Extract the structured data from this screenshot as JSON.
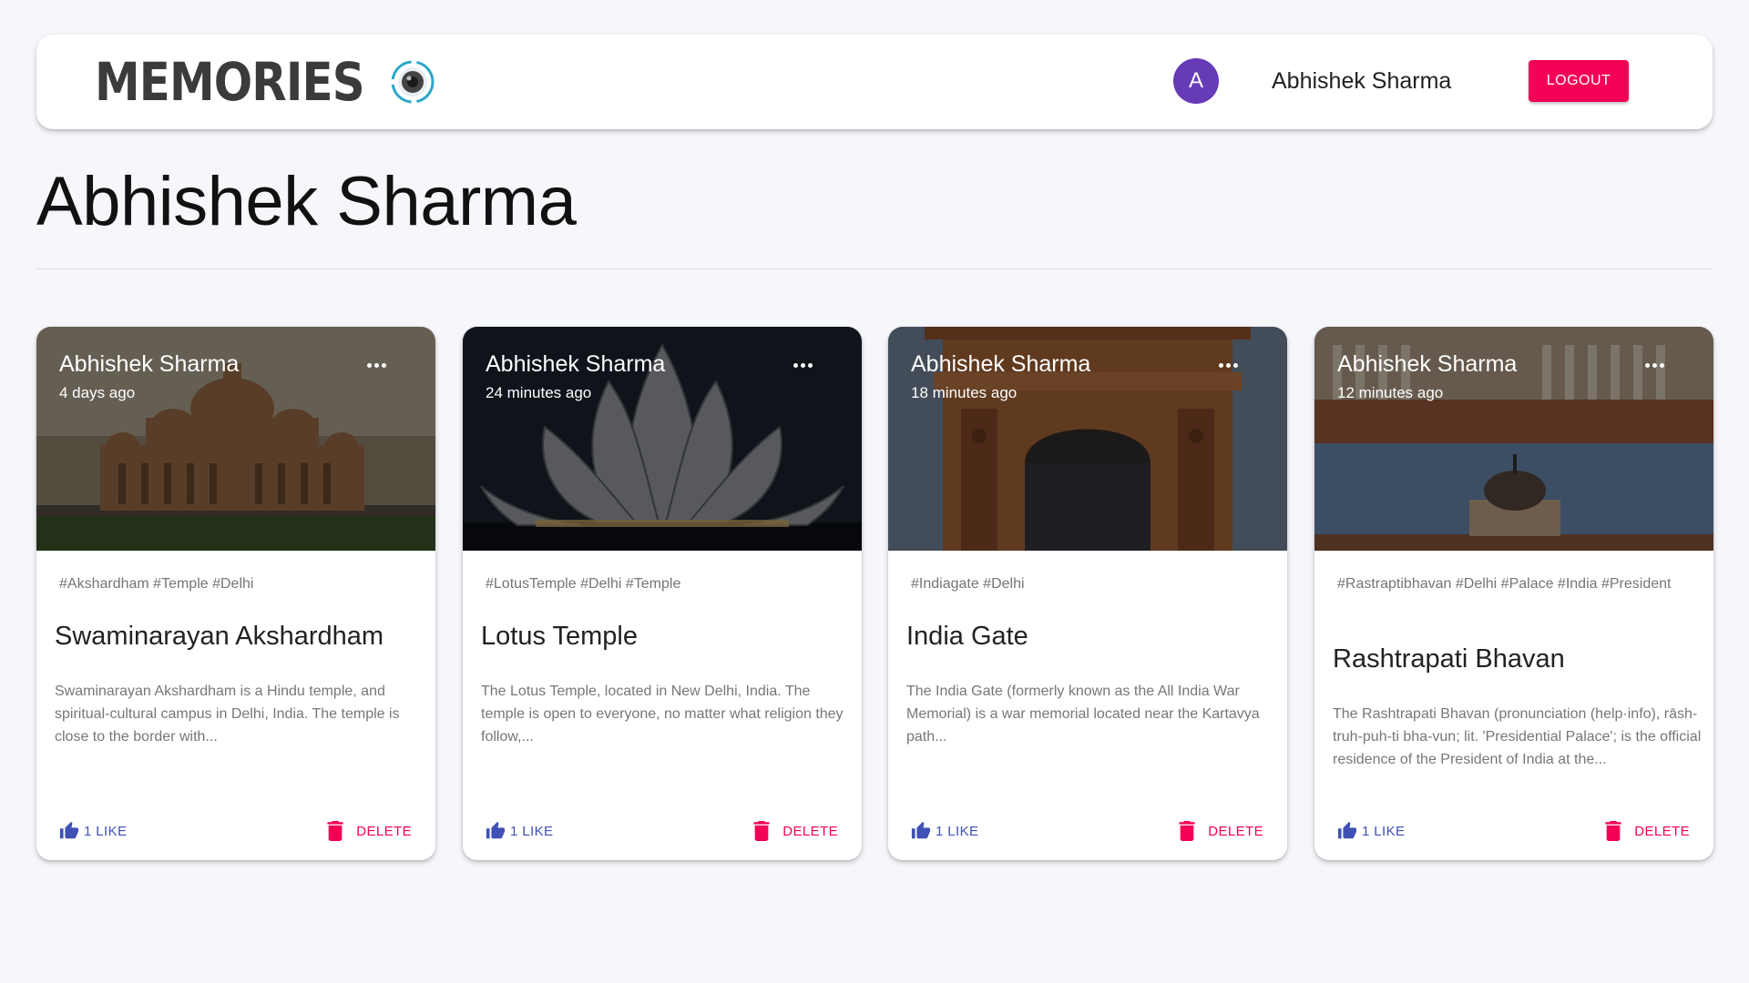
{
  "appbar": {
    "brand_title": "Memories",
    "avatar_initial": "A",
    "username": "Abhishek Sharma",
    "logout_label": "LOGOUT"
  },
  "page": {
    "title": "Abhishek Sharma"
  },
  "colors": {
    "accent": "#f50057",
    "primary": "#3f51b5",
    "avatar": "#673ab7"
  },
  "posts": [
    {
      "author": "Abhishek Sharma",
      "time": "4 days ago",
      "tags": "#Akshardham #Temple #Delhi",
      "title": "Swaminarayan Akshardham",
      "description": "Swaminarayan Akshardham is a Hindu temple, and spiritual-cultural campus in Delhi, India. The temple is close to the border with...",
      "like_label": "1 LIKE",
      "delete_label": "DELETE",
      "image": "akshardham-temple"
    },
    {
      "author": "Abhishek Sharma",
      "time": "24 minutes ago",
      "tags": "#LotusTemple #Delhi #Temple",
      "title": "Lotus Temple",
      "description": "The Lotus Temple, located in New Delhi, India. The temple is open to everyone, no matter what religion they follow,...",
      "like_label": "1 LIKE",
      "delete_label": "DELETE",
      "image": "lotus-temple"
    },
    {
      "author": "Abhishek Sharma",
      "time": "18 minutes ago",
      "tags": "#Indiagate #Delhi",
      "title": "India Gate",
      "description": "The India Gate (formerly known as the All India War Memorial) is a war memorial located near the Kartavya path...",
      "like_label": "1 LIKE",
      "delete_label": "DELETE",
      "image": "india-gate"
    },
    {
      "author": "Abhishek Sharma",
      "time": "12 minutes ago",
      "tags": "#Rastraptibhavan #Delhi #Palace #India #President",
      "title": "Rashtrapati Bhavan",
      "description": "The Rashtrapati Bhavan (pronunciation (help·info), rāsh-truh-puh-ti bha-vun; lit. 'Presidential Palace'; is the official residence of the President of India at the...",
      "like_label": "1 LIKE",
      "delete_label": "DELETE",
      "image": "rashtrapati-bhavan"
    }
  ]
}
